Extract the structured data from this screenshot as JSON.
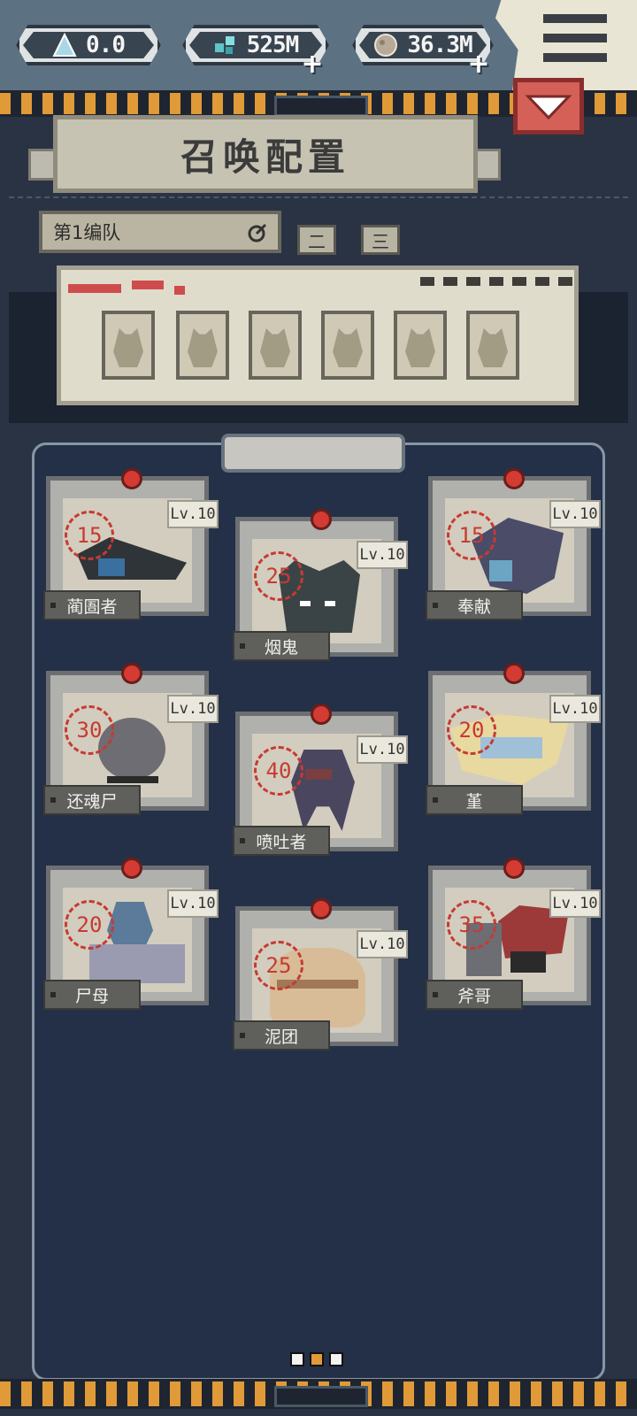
{
  "resources": [
    {
      "icon": "triangle-crystal-icon",
      "value": "0.0",
      "has_plus": false
    },
    {
      "icon": "gem-cluster-icon",
      "value": "525M",
      "has_plus": true
    },
    {
      "icon": "stone-orb-icon",
      "value": "36.3M",
      "has_plus": true
    }
  ],
  "header": {
    "title": "召唤配置"
  },
  "team": {
    "selected": "第1编队",
    "tabs": [
      "二",
      "三"
    ]
  },
  "formation": {
    "slots": 6
  },
  "cards": [
    {
      "name": "蔺圄者",
      "level": "Lv.10",
      "cost": "15"
    },
    {
      "name": "烟鬼",
      "level": "Lv.10",
      "cost": "25"
    },
    {
      "name": "奉献",
      "level": "Lv.10",
      "cost": "15"
    },
    {
      "name": "还魂尸",
      "level": "Lv.10",
      "cost": "30"
    },
    {
      "name": "喷吐者",
      "level": "Lv.10",
      "cost": "40"
    },
    {
      "name": "堇",
      "level": "Lv.10",
      "cost": "20"
    },
    {
      "name": "尸母",
      "level": "Lv.10",
      "cost": "20"
    },
    {
      "name": "泥团",
      "level": "Lv.10",
      "cost": "25"
    },
    {
      "name": "斧哥",
      "level": "Lv.10",
      "cost": "35"
    }
  ],
  "pager": {
    "pages": 3,
    "active": 2
  },
  "colors": {
    "accent": "#e09a37",
    "danger": "#d46058",
    "panel": "#243047"
  }
}
